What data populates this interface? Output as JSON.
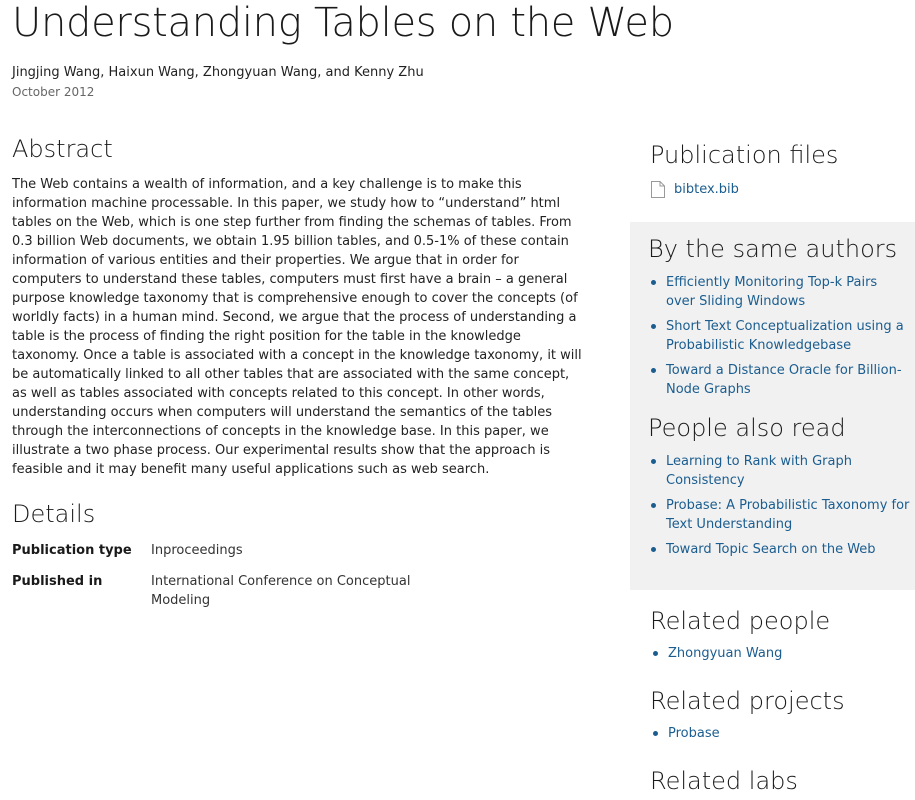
{
  "page": {
    "title": "Understanding Tables on the Web",
    "authors": "Jingjing Wang, Haixun Wang, Zhongyuan Wang, and Kenny Zhu",
    "date": "October 2012"
  },
  "abstract": {
    "heading": "Abstract",
    "text": "The Web contains a wealth of information, and a key challenge is to make this information machine processable. In this paper, we study how to “understand” html tables on the Web, which is one step further from finding the schemas of tables. From 0.3 billion Web documents, we obtain 1.95 billion tables, and 0.5-1% of these contain information of various entities and their properties. We argue that in order for computers to understand these tables, computers must first have a brain – a general purpose knowledge taxonomy that is comprehensive enough to cover the concepts (of worldly facts) in a human mind. Second, we argue that the process of understanding a table is the process of finding the right position for the table in the knowledge taxonomy. Once a table is associated with a concept in the knowledge taxonomy, it will be automatically linked to all other tables that are associated with the same concept, as well as tables associated with concepts related to this concept. In other words, understanding occurs when computers will understand the semantics of the tables through the interconnections of concepts in the knowledge base. In this paper, we illustrate a two phase process. Our experimental results show that the approach is feasible and it may benefit many useful applications such as web search."
  },
  "details": {
    "heading": "Details",
    "rows": [
      {
        "label": "Publication type",
        "value": "Inproceedings"
      },
      {
        "label": "Published in",
        "value": "International Conference on Conceptual Modeling"
      }
    ]
  },
  "sidebar": {
    "publication_files": {
      "heading": "Publication files",
      "file_label": "bibtex.bib",
      "file_icon": "document-icon"
    },
    "same_authors": {
      "heading": "By the same authors",
      "items": [
        "Efficiently Monitoring Top-k Pairs over Sliding Windows",
        "Short Text Conceptualization using a Probabilistic Knowledgebase",
        "Toward a Distance Oracle for Billion-Node Graphs"
      ]
    },
    "people_also_read": {
      "heading": "People also read",
      "items": [
        "Learning to Rank with Graph Consistency",
        "Probase: A Probabilistic Taxonomy for Text Understanding",
        "Toward Topic Search on the Web"
      ]
    },
    "related_people": {
      "heading": "Related people",
      "items": [
        "Zhongyuan Wang"
      ]
    },
    "related_projects": {
      "heading": "Related projects",
      "items": [
        "Probase"
      ]
    },
    "related_labs": {
      "heading": "Related labs"
    }
  },
  "colors": {
    "link": "#1b5d8f",
    "panel_bg": "#f1f1f1",
    "text": "#222222",
    "muted": "#666666"
  }
}
